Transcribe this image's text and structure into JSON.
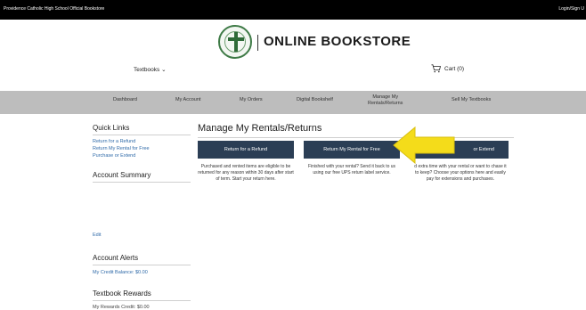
{
  "topbar": {
    "left_text": "Providence Catholic High School Official Bookstore",
    "right_text": "Login/Sign U"
  },
  "logo": {
    "title": "ONLINE BOOKSTORE"
  },
  "nav": {
    "textbooks_label": "Textbooks",
    "cart_label": "Cart (0)"
  },
  "menu": {
    "items": [
      {
        "label": "Dashboard"
      },
      {
        "label": "My Account"
      },
      {
        "label": "My Orders"
      },
      {
        "label": "Digital Bookshelf"
      },
      {
        "label": "Manage My\nRentals/Returns"
      },
      {
        "label": "Sell My Textbooks"
      }
    ]
  },
  "sidebar": {
    "quick_links_heading": "Quick Links",
    "quick_links": [
      "Return for a Refund",
      "Return My Rental for Free",
      "Purchase or Extend"
    ],
    "account_summary_heading": "Account Summary",
    "edit_label": "Edit",
    "account_alerts_heading": "Account Alerts",
    "credit_balance": "My Credit Balance: $0.00",
    "rewards_heading": "Textbook Rewards",
    "rewards_credit": "My Rewards Credit: $0.00"
  },
  "main": {
    "title": "Manage My Rentals/Returns",
    "cards": [
      {
        "button": "Return for a Refund",
        "text": "Purchased and rented items are eligible to be returned for any reason within 30 days after start of term. Start your return here."
      },
      {
        "button": "Return My Rental for Free",
        "text": "Finished with your rental? Send it back to us using our free UPS return label service."
      },
      {
        "button": "or Extend",
        "text": "d extra time with your rental or want to chase it to keep? Choose your options here and easily pay for extensions and purchases."
      }
    ]
  },
  "colors": {
    "button_bg": "#2b3e55",
    "menubar_bg": "#bdbdbd",
    "link": "#2f6aa8",
    "arrow": "#f4dc1a"
  }
}
